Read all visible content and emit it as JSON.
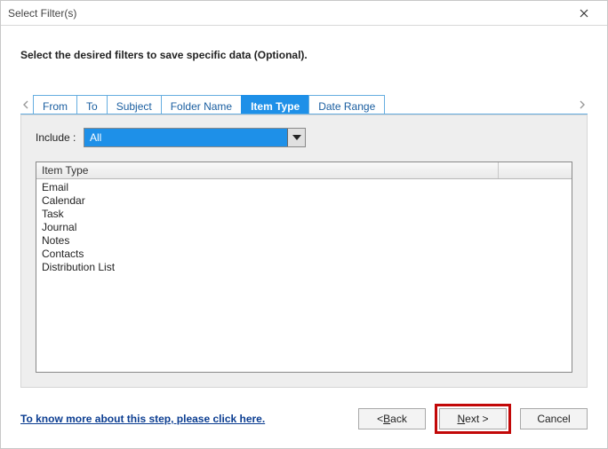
{
  "window": {
    "title": "Select Filter(s)"
  },
  "instruction": "Select the desired filters to save specific data (Optional).",
  "tabs": {
    "items": [
      "From",
      "To",
      "Subject",
      "Folder Name",
      "Item Type",
      "Date Range"
    ],
    "active_index": 4
  },
  "panel": {
    "include_label": "Include :",
    "include_value": "All",
    "list_header": "Item Type",
    "list_items": [
      "Email",
      "Calendar",
      "Task",
      "Journal",
      "Notes",
      "Contacts",
      "Distribution List"
    ]
  },
  "footer": {
    "help_link": "To know more about this step, please click here.",
    "back_prefix": "< ",
    "back_u": "B",
    "back_rest": "ack",
    "next_u": "N",
    "next_rest": "ext >",
    "cancel": "Cancel"
  }
}
